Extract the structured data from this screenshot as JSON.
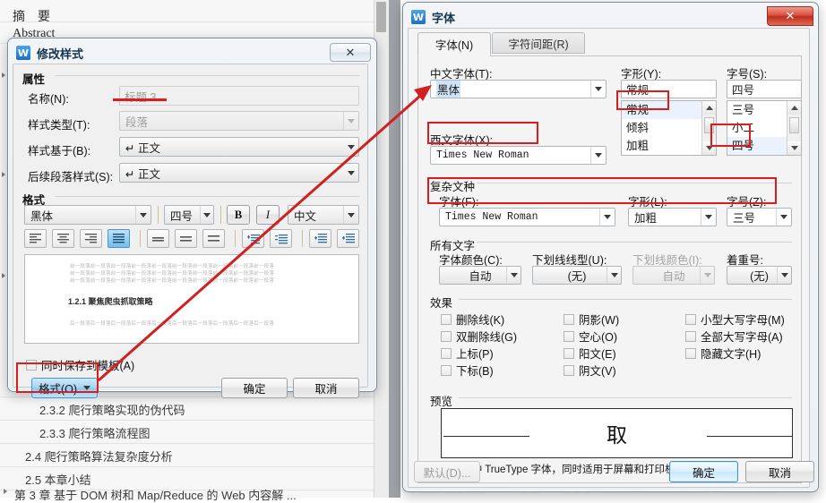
{
  "background_doc": {
    "heading_cn": "摘　要",
    "heading_en": "Abstract",
    "nav_items": [
      "2.3.2  爬行策略实现的伪代码",
      "2.3.3  爬行策略流程图",
      "2.4  爬行策略算法复杂度分析",
      "2.5  本章小结",
      "第 3 章  基于 DOM 树和 Map/Reduce 的 Web 内容解 ..."
    ]
  },
  "modify_style_dialog": {
    "title": "修改样式",
    "app_icon": "wps-icon",
    "close_label": "✕",
    "properties_group": "属性",
    "fields": {
      "name_label": "名称(N):",
      "name_value": "标题 3",
      "type_label": "样式类型(T):",
      "type_value": "段落",
      "based_on_label": "样式基于(B):",
      "based_on_value": "↵ 正文",
      "next_style_label": "后续段落样式(S):",
      "next_style_value": "↵ 正文"
    },
    "format_group": "格式",
    "toolbar": {
      "font_family": "黑体",
      "font_size": "四号",
      "bold_label": "B",
      "italic_label": "I",
      "script_label": "中文",
      "align_icons": [
        "align-left-icon",
        "align-center-icon",
        "align-right-icon",
        "align-justify-icon",
        "line-spacing-single-icon",
        "line-spacing-1_5-icon",
        "line-spacing-double-icon",
        "spacing-before-icon",
        "spacing-after-icon",
        "decrease-indent-icon",
        "increase-indent-icon"
      ]
    },
    "preview": {
      "filler_line": "前一段落前一段落前一段落前一段落前一段落前一段落前一段落前一段落前一段落前一段落",
      "heading_sample": "1.2.1  聚焦爬虫抓取策略",
      "after_line": "后一段落后一段落后一段落后一段落后一段落后一段落后一段落后一段落后一段落后一段落"
    },
    "save_to_template_label": "同时保存到模板(A)",
    "format_button": "格式(O)",
    "ok_button": "确定",
    "cancel_button": "取消"
  },
  "font_dialog": {
    "title": "字体",
    "app_icon": "wps-icon",
    "close_label": "✕",
    "tabs": [
      {
        "label": "字体(N)",
        "active": true
      },
      {
        "label": "字符间距(R)",
        "active": false
      }
    ],
    "latin_section": {
      "cn_font_label": "中文字体(T):",
      "cn_font_value": "黑体",
      "western_font_label": "西文字体(X):",
      "western_font_value": "Times New Roman",
      "style_label": "字形(Y):",
      "style_value": "常规",
      "style_options": [
        "常规",
        "倾斜",
        "加粗"
      ],
      "style_selected": "常规",
      "size_label": "字号(S):",
      "size_value": "四号",
      "size_options": [
        "三号",
        "小二",
        "四号"
      ],
      "size_selected": "四号"
    },
    "complex_section": {
      "group_label": "复杂文种",
      "font_label": "字体(F):",
      "font_value": "Times New Roman",
      "style_label": "字形(L):",
      "style_value": "加粗",
      "size_label": "字号(Z):",
      "size_value": "三号"
    },
    "all_text_section": {
      "group_label": "所有文字",
      "color_label": "字体颜色(C):",
      "color_value": "自动",
      "underline_style_label": "下划线线型(U):",
      "underline_style_value": "(无)",
      "underline_color_label": "下划线颜色(I):",
      "underline_color_value": "自动",
      "emphasis_label": "着重号:",
      "emphasis_value": "(无)"
    },
    "effects_section": {
      "group_label": "效果",
      "col1": [
        "删除线(K)",
        "双删除线(G)",
        "上标(P)",
        "下标(B)"
      ],
      "col2": [
        "阴影(W)",
        "空心(O)",
        "阳文(E)",
        "阴文(V)"
      ],
      "col3": [
        "小型大写字母(M)",
        "全部大写字母(A)",
        "隐藏文字(H)"
      ]
    },
    "preview_section": {
      "group_label": "预览",
      "sample_glyph": "取",
      "note": "这是一种 TrueType 字体，同时适用于屏幕和打印机。"
    },
    "default_button": "默认(D)...",
    "ok_button": "确定",
    "cancel_button": "取消"
  },
  "annotations": {
    "accent_color": "#e01b1b",
    "underline_name_field": "red-underline-name",
    "boxes": [
      "western-font-box",
      "style-selected-box",
      "size-selected-box",
      "complex-row-box",
      "format-button-box"
    ],
    "arrows": [
      "format-button-to-cn-font-arrow"
    ]
  }
}
